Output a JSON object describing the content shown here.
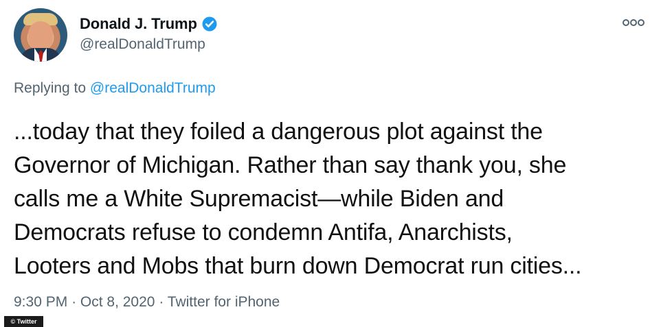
{
  "tweet": {
    "author": {
      "display_name": "Donald J. Trump",
      "handle": "@realDonaldTrump",
      "avatar_icon": "profile-photo",
      "verified_icon": "verified-badge-icon",
      "verified_color": "#1d9bf0"
    },
    "more_icon": "more-options-icon",
    "reply_context": {
      "prefix": "Replying to",
      "mention": "@realDonaldTrump"
    },
    "text_lines": [
      "...today that they foiled a dangerous plot against the",
      "Governor of Michigan. Rather than say thank you, she",
      "calls me a White Supremacist—while Biden and",
      "Democrats refuse to condemn Antifa, Anarchists,",
      "Looters and Mobs that burn down Democrat run cities..."
    ],
    "timestamp": {
      "time": "9:30 PM",
      "separator_1": "·",
      "date": "Oct 8, 2020",
      "separator_2": "·",
      "source": "Twitter for iPhone"
    },
    "watermark": "© Twitter",
    "colors": {
      "link": "#1d9bf0",
      "secondary_text": "#536471",
      "primary_text": "#0f1419",
      "background": "#ffffff"
    }
  }
}
